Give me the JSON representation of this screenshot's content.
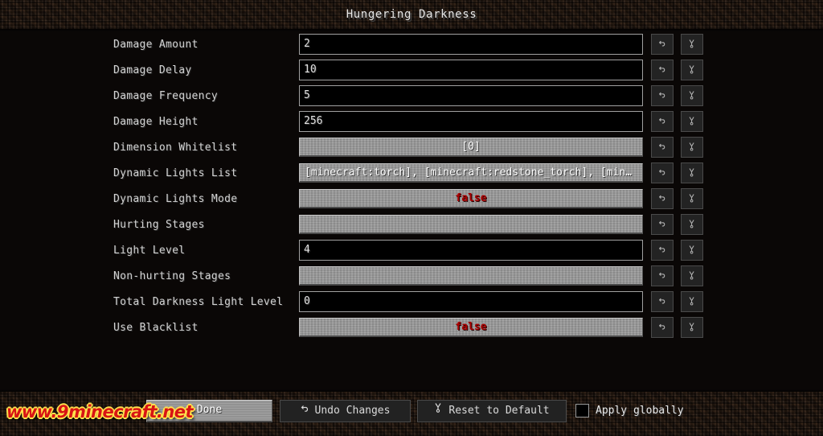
{
  "window": {
    "title": "Hungering Darkness"
  },
  "options": [
    {
      "label": "Damage Amount",
      "type": "field",
      "value": "2"
    },
    {
      "label": "Damage Delay",
      "type": "field",
      "value": "10"
    },
    {
      "label": "Damage Frequency",
      "type": "field",
      "value": "5"
    },
    {
      "label": "Damage Height",
      "type": "field",
      "value": "256"
    },
    {
      "label": "Dimension Whitelist",
      "type": "button",
      "value": "[0]",
      "align": "center"
    },
    {
      "label": "Dynamic Lights List",
      "type": "button",
      "value": "[minecraft:torch], [minecraft:redstone_torch], [min…",
      "align": "left"
    },
    {
      "label": "Dynamic Lights Mode",
      "type": "button",
      "value": "false",
      "align": "center",
      "style": "false"
    },
    {
      "label": "Hurting Stages",
      "type": "button",
      "value": "",
      "align": "center"
    },
    {
      "label": "Light Level",
      "type": "field",
      "value": "4"
    },
    {
      "label": "Non-hurting Stages",
      "type": "button",
      "value": "",
      "align": "center"
    },
    {
      "label": "Total Darkness Light Level",
      "type": "field",
      "value": "0"
    },
    {
      "label": "Use Blacklist",
      "type": "button",
      "value": "false",
      "align": "center",
      "style": "false"
    }
  ],
  "row_controls": {
    "undo_icon": "undo-arrow-icon",
    "reset_icon": "reset-to-default-icon"
  },
  "footer": {
    "done_label": "Done",
    "undo_changes_label": "Undo Changes",
    "undo_changes_icon": "undo-arrow-icon",
    "reset_default_label": "Reset to Default",
    "reset_default_icon": "reset-to-default-icon",
    "apply_globally_label": "Apply globally",
    "apply_globally_checked": false
  },
  "watermark": {
    "text": "www.9minecraft.net"
  },
  "colors": {
    "false_value": "#aa0000",
    "label_text": "#d2d2d2",
    "button_face": "#9a9a9a",
    "watermark_fill": "#d81414",
    "watermark_outline": "#ffe14d"
  }
}
